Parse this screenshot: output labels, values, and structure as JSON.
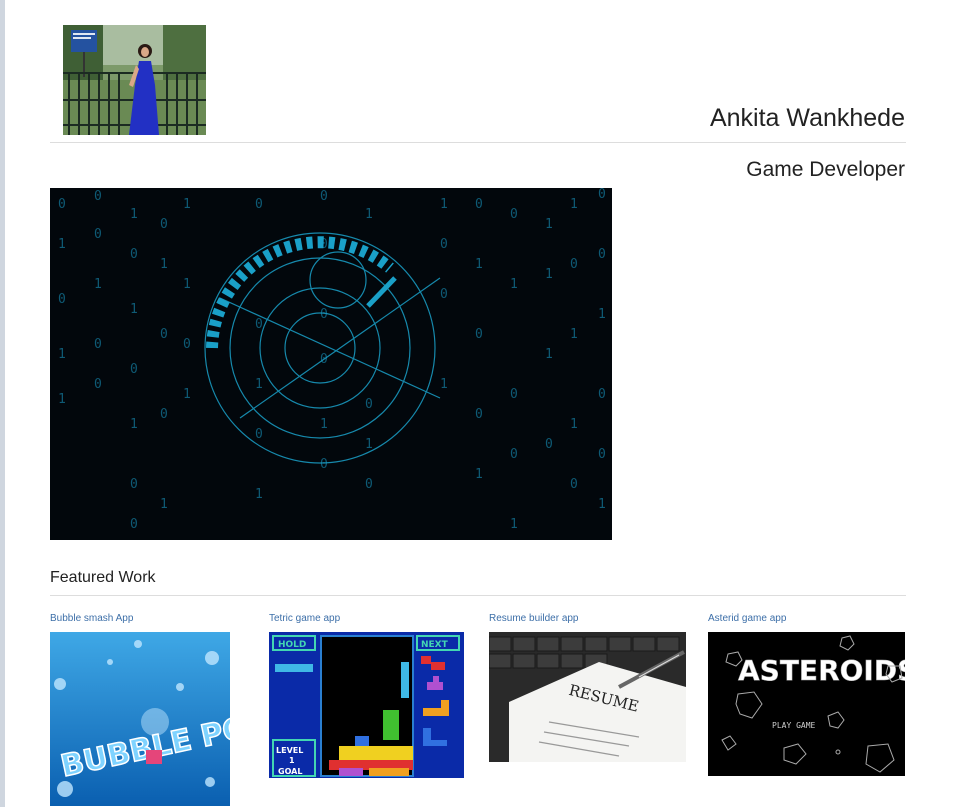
{
  "profile": {
    "name": "Ankita Wankhede",
    "subtitle": "Game Developer"
  },
  "featured": {
    "heading": "Featured Work",
    "items": [
      {
        "label": "Bubble smash App",
        "thumb_text": "BUBBLE POP"
      },
      {
        "label": "Tetric game app",
        "hold": "HOLD",
        "next": "NEXT",
        "level": "LEVEL",
        "level_num": "1",
        "goal": "GOAL"
      },
      {
        "label": "Resume builder app",
        "thumb_text": "RESUME"
      },
      {
        "label": "Asterid game app",
        "thumb_text": "ASTEROIDS",
        "sub_text": "PLAY GAME"
      }
    ]
  },
  "colors": {
    "link": "#3d6fa8",
    "rule": "#dddddd",
    "hero_bg": "#02070c",
    "hero_accent": "#1aa0c8"
  }
}
